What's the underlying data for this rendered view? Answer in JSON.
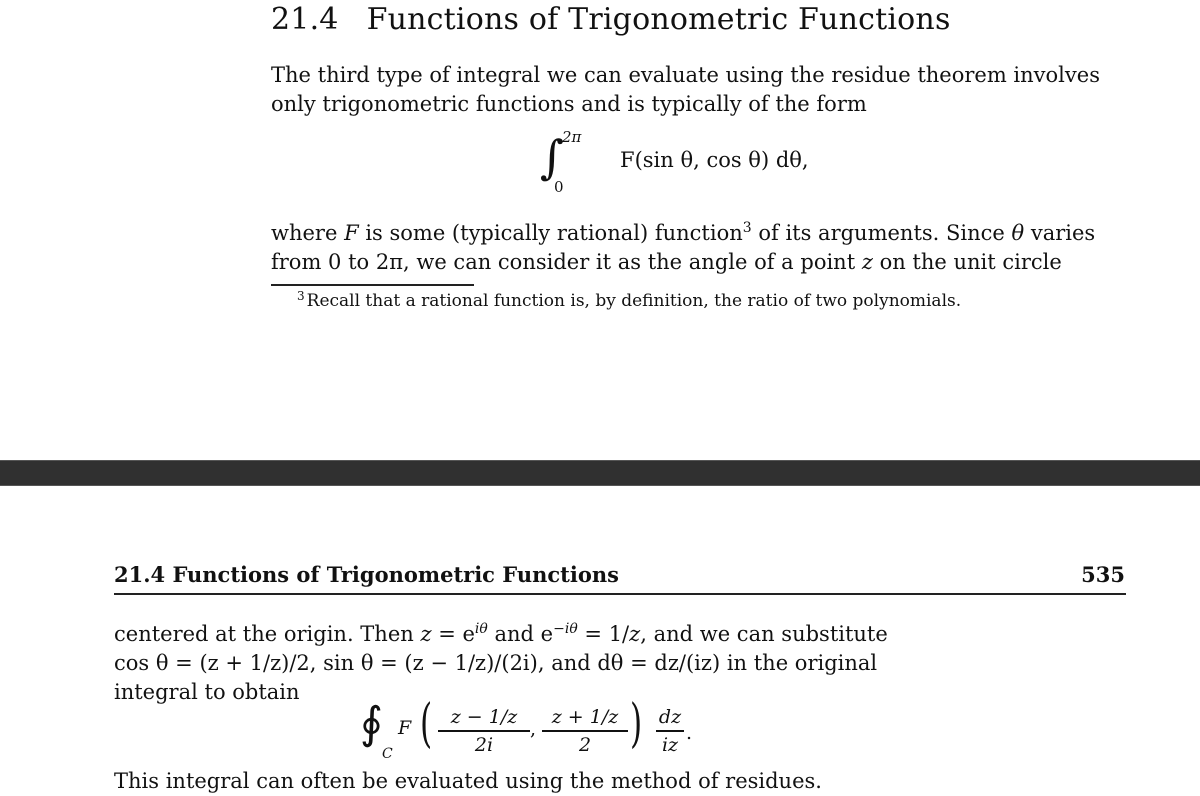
{
  "top_page": {
    "section_number": "21.4",
    "section_title": "Functions of Trigonometric Functions",
    "paragraph1_line1": "The third type of integral we can evaluate using the residue theorem involves",
    "paragraph1_line2": "only trigonometric functions and is typically of the form",
    "equation1": {
      "upper_limit": "2π",
      "lower_limit": "0",
      "integrand": "F(sin θ, cos θ) dθ,"
    },
    "paragraph2_line1_a": "where ",
    "paragraph2_line1_F": "F",
    "paragraph2_line1_b": " is some (typically rational) function",
    "paragraph2_line1_fnmark": "3",
    "paragraph2_line1_c": " of its arguments. Since ",
    "paragraph2_line1_theta": "θ",
    "paragraph2_line1_d": " varies",
    "paragraph2_line2_a": "from 0 to 2π, we can consider it as the angle of a point ",
    "paragraph2_line2_z": "z",
    "paragraph2_line2_b": " on the unit circle",
    "footnote_mark": "3",
    "footnote_text": "Recall that a rational function is, by definition, the ratio of two polynomials."
  },
  "bottom_page": {
    "running_head": "21.4 Functions of Trigonometric Functions",
    "page_number": "535",
    "paragraph3_line1": "centered at the origin. Then z = e^{iθ} and e^{−iθ} = 1/z, and we can substitute",
    "p3l1": {
      "a": "centered at the origin. Then ",
      "z1": "z",
      "eq": " = e",
      "exp1": "iθ",
      "b": " and e",
      "exp2": "−iθ",
      "c": " = 1/",
      "z2": "z",
      "d": ", and we can substitute"
    },
    "paragraph3_line2": "cos θ = (z + 1/z)/2, sin θ = (z − 1/z)/(2i), and dθ = dz/(iz) in the original",
    "paragraph3_line3": "integral to obtain",
    "equation2": {
      "contour": "C",
      "function": "F",
      "frac1_num": "z − 1/z",
      "frac1_den": "2i",
      "frac2_num": "z + 1/z",
      "frac2_den": "2",
      "frac3_num": "dz",
      "frac3_den": "iz"
    },
    "paragraph4": "This integral can often be evaluated using the method of residues."
  }
}
